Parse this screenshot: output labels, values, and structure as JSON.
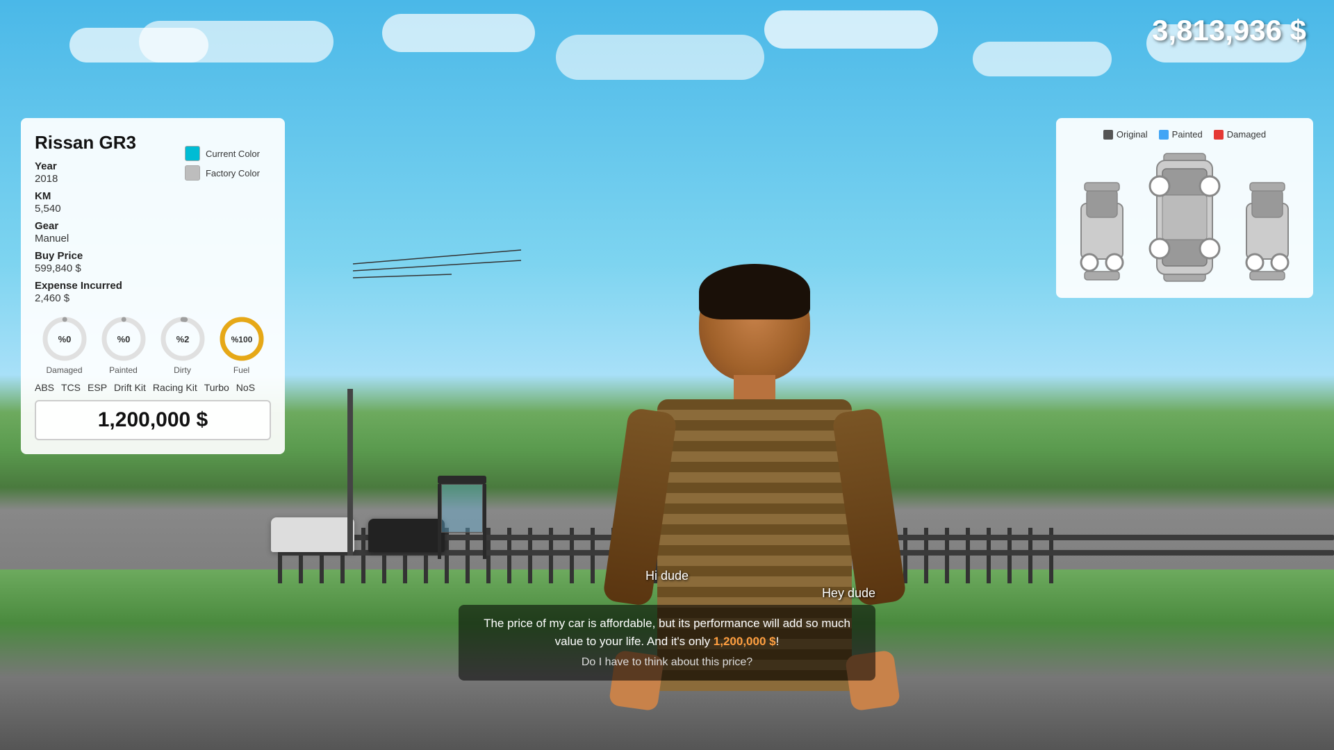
{
  "hud": {
    "money": "3,813,936 $"
  },
  "car_panel": {
    "title": "Rissan GR3",
    "current_color_label": "Current Color",
    "factory_color_label": "Factory Color",
    "current_color_hex": "#00bcd4",
    "factory_color_hex": "#bdbdbd",
    "year_label": "Year",
    "year_value": "2018",
    "km_label": "KM",
    "km_value": "5,540",
    "gear_label": "Gear",
    "gear_value": "Manuel",
    "buy_price_label": "Buy Price",
    "buy_price_value": "599,840 $",
    "expense_label": "Expense Incurred",
    "expense_value": "2,460 $",
    "gauges": [
      {
        "label": "Damaged",
        "value": "%0",
        "percent": 0,
        "color": "#9e9e9e",
        "bg": "#e0e0e0"
      },
      {
        "label": "Painted",
        "value": "%0",
        "percent": 0,
        "color": "#9e9e9e",
        "bg": "#e0e0e0"
      },
      {
        "label": "Dirty",
        "value": "%2",
        "percent": 2,
        "color": "#9e9e9e",
        "bg": "#e0e0e0"
      },
      {
        "label": "Fuel",
        "value": "%100",
        "percent": 100,
        "color": "#e6a817",
        "bg": "#e0e0e0"
      }
    ],
    "tags": [
      "ABS",
      "TCS",
      "ESP",
      "Drift Kit",
      "Racing Kit",
      "Turbo",
      "NoS"
    ],
    "price_buy_value": "1,200,000 $"
  },
  "diagram_panel": {
    "legend": [
      {
        "label": "Original",
        "color": "#555"
      },
      {
        "label": "Painted",
        "color": "#42a5f5"
      },
      {
        "label": "Damaged",
        "color": "#e53935"
      }
    ]
  },
  "dialogue": {
    "greeting_left": "Hi dude",
    "greeting_right": "Hey dude",
    "main_text": "The price of my car is affordable, but its performance will add so much value to your life. And it's only 1,200,000 $!",
    "highlight": "1,200,000 $",
    "question": "Do I have to think about this price?"
  }
}
